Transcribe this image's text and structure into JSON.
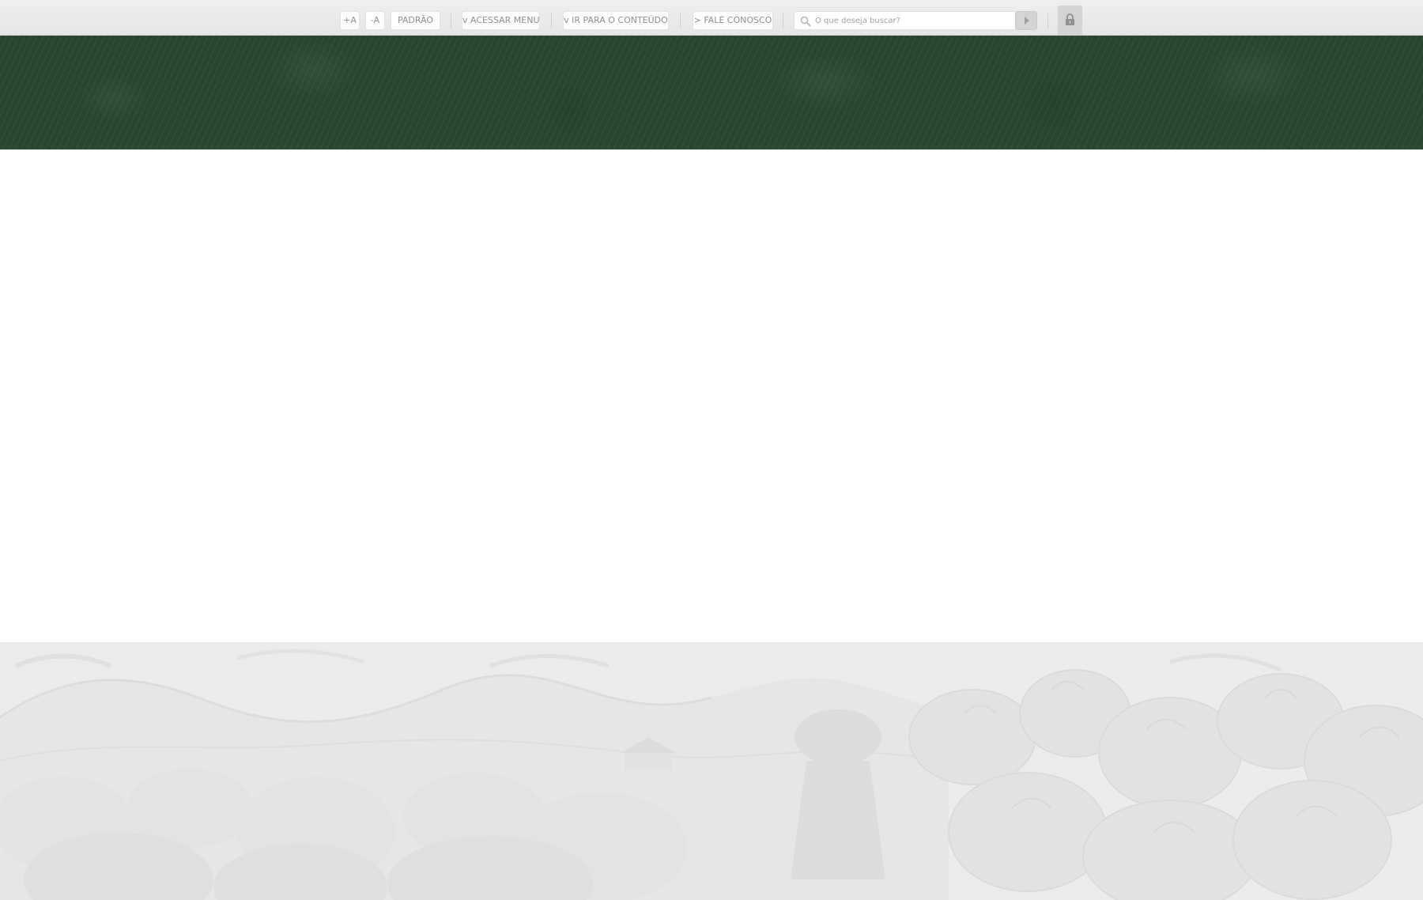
{
  "accessibility_bar": {
    "increase_font": "+A",
    "decrease_font": "-A",
    "default_font": "PADRÃO",
    "access_menu": "v ACESSAR MENU",
    "go_to_content": "v IR PARA O CONTEÚDO",
    "contact": "> FALE CONOSCO"
  },
  "search": {
    "placeholder": "O que deseja buscar?",
    "icon": "search-icon",
    "submit_icon": "arrow-right-icon"
  },
  "login": {
    "icon": "lock-icon"
  },
  "colors": {
    "banner_green": "#28472f",
    "topbar_bg": "#e9e9e9",
    "footer_bg": "#ececec",
    "button_text": "#8e8e8e"
  }
}
